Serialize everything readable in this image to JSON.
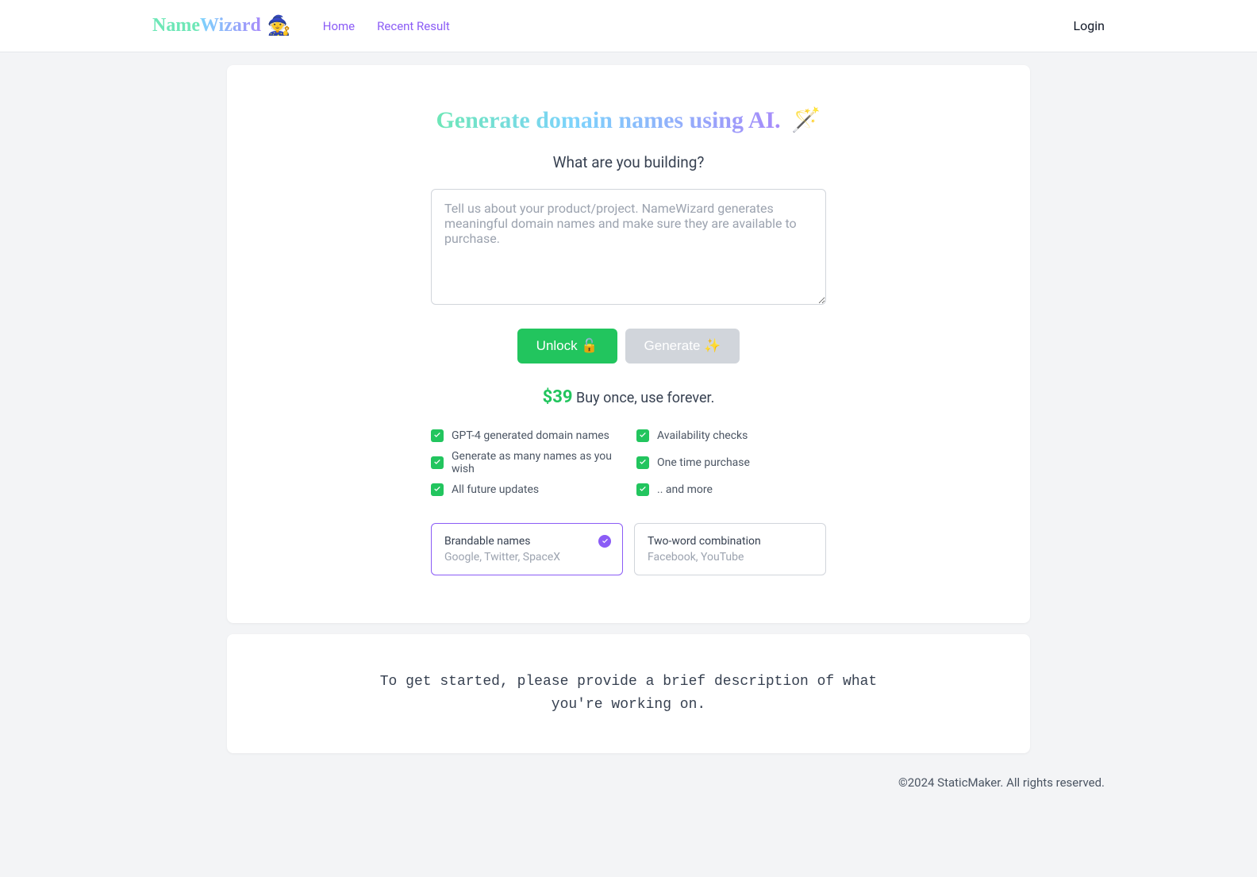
{
  "header": {
    "logo_name": "Name",
    "logo_wizard": "Wizard",
    "logo_emoji": "🧙",
    "nav": {
      "home": "Home",
      "recent": "Recent Result"
    },
    "login": "Login"
  },
  "hero": {
    "title": "Generate domain names using AI.",
    "emoji": "🪄",
    "subtitle": "What are you building?",
    "placeholder": "Tell us about your product/project. NameWizard generates meaningful domain names and make sure they are available to purchase."
  },
  "buttons": {
    "unlock": "Unlock 🔓",
    "generate": "Generate ✨"
  },
  "pricing": {
    "price": "$39",
    "text": "Buy once, use forever."
  },
  "features": [
    "GPT-4 generated domain names",
    "Availability checks",
    "Generate as many names as you wish",
    "One time purchase",
    "All future updates",
    ".. and more"
  ],
  "options": {
    "brandable": {
      "title": "Brandable names",
      "subtitle": "Google, Twitter, SpaceX"
    },
    "twoword": {
      "title": "Two-word combination",
      "subtitle": "Facebook, YouTube"
    }
  },
  "getting_started": "To get started, please provide a brief description of what you're working on.",
  "footer": "©2024 StaticMaker. All rights reserved."
}
